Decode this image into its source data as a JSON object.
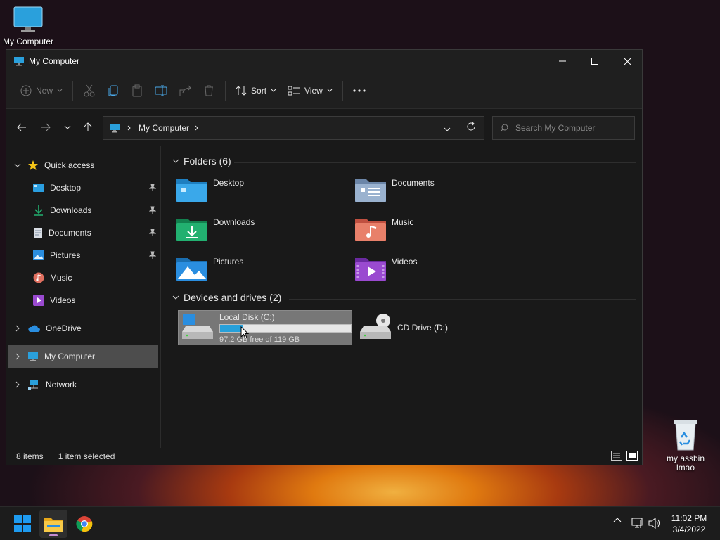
{
  "desktop": {
    "icons": [
      {
        "label": "My Computer"
      },
      {
        "label": "my assbin lmao"
      }
    ]
  },
  "window": {
    "title": "My Computer",
    "toolbar": {
      "new_label": "New",
      "sort_label": "Sort",
      "view_label": "View"
    },
    "address": {
      "crumb": "My Computer"
    },
    "search": {
      "placeholder": "Search My Computer"
    },
    "sidebar": {
      "quick_access": "Quick access",
      "items": [
        {
          "label": "Desktop",
          "pinned": true
        },
        {
          "label": "Downloads",
          "pinned": true
        },
        {
          "label": "Documents",
          "pinned": true
        },
        {
          "label": "Pictures",
          "pinned": true
        },
        {
          "label": "Music",
          "pinned": false
        },
        {
          "label": "Videos",
          "pinned": false
        }
      ],
      "onedrive": "OneDrive",
      "my_computer": "My Computer",
      "network": "Network"
    },
    "content": {
      "folders_header": "Folders (6)",
      "folders": [
        {
          "name": "Desktop",
          "color": "#3aa0e0"
        },
        {
          "name": "Documents",
          "color": "#8fa5c0"
        },
        {
          "name": "Downloads",
          "color": "#22a86a"
        },
        {
          "name": "Music",
          "color": "#e07060"
        },
        {
          "name": "Pictures",
          "color": "#2a8ee0"
        },
        {
          "name": "Videos",
          "color": "#9a4ad0"
        }
      ],
      "drives_header": "Devices and drives (2)",
      "drives": [
        {
          "name": "Local Disk (C:)",
          "free_text": "97.2 GB free of 119 GB",
          "used_fraction": 0.18,
          "selected": true
        },
        {
          "name": "CD Drive (D:)",
          "selected": false
        }
      ]
    },
    "status": {
      "items": "8 items",
      "selected": "1 item selected"
    }
  },
  "taskbar": {
    "time": "11:02 PM",
    "date": "3/4/2022",
    "accent": "#0078d4"
  }
}
